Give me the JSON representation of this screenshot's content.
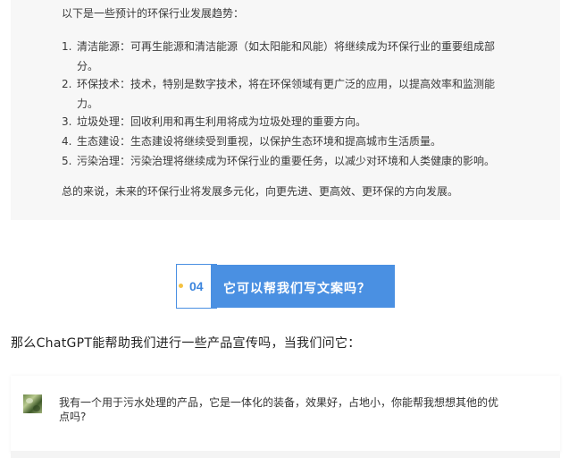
{
  "answer": {
    "intro": "以下是一些预计的环保行业发展趋势：",
    "items": [
      {
        "num": "1.",
        "line1": "清洁能源：可再生能源和清洁能源（如太阳能和风能）将继续成为环保行业的重要组成部",
        "line2": "分。"
      },
      {
        "num": "2.",
        "line1": "环保技术：技术，特别是数字技术，将在环保领域有更广泛的应用，以提高效率和监测能",
        "line2": "力。"
      },
      {
        "num": "3.",
        "line1": "垃圾处理：回收利用和再生利用将成为垃圾处理的重要方向。",
        "line2": ""
      },
      {
        "num": "4.",
        "line1": "生态建设：生态建设将继续受到重视，以保护生态环境和提高城市生活质量。",
        "line2": ""
      },
      {
        "num": "5.",
        "line1": "污染治理：污染治理将继续成为环保行业的重要任务，以减少对环境和人类健康的影响。",
        "line2": ""
      }
    ],
    "summary": "总的来说，未来的环保行业将发展多元化，向更先进、更高效、更环保的方向发展。"
  },
  "section": {
    "number": "04",
    "title": "它可以帮我们写文案吗？"
  },
  "question_line": "那么ChatGPT能帮助我们进行一些产品宣传吗，当我们问它：",
  "chat": {
    "message": "我有一个用于污水处理的产品，它是一体化的装备，效果好，占地小，你能帮我想想其他的优点吗?"
  },
  "colors": {
    "accent": "#4a90e2",
    "dot": "#f5c242",
    "panel_bg": "#f7f7f7"
  }
}
